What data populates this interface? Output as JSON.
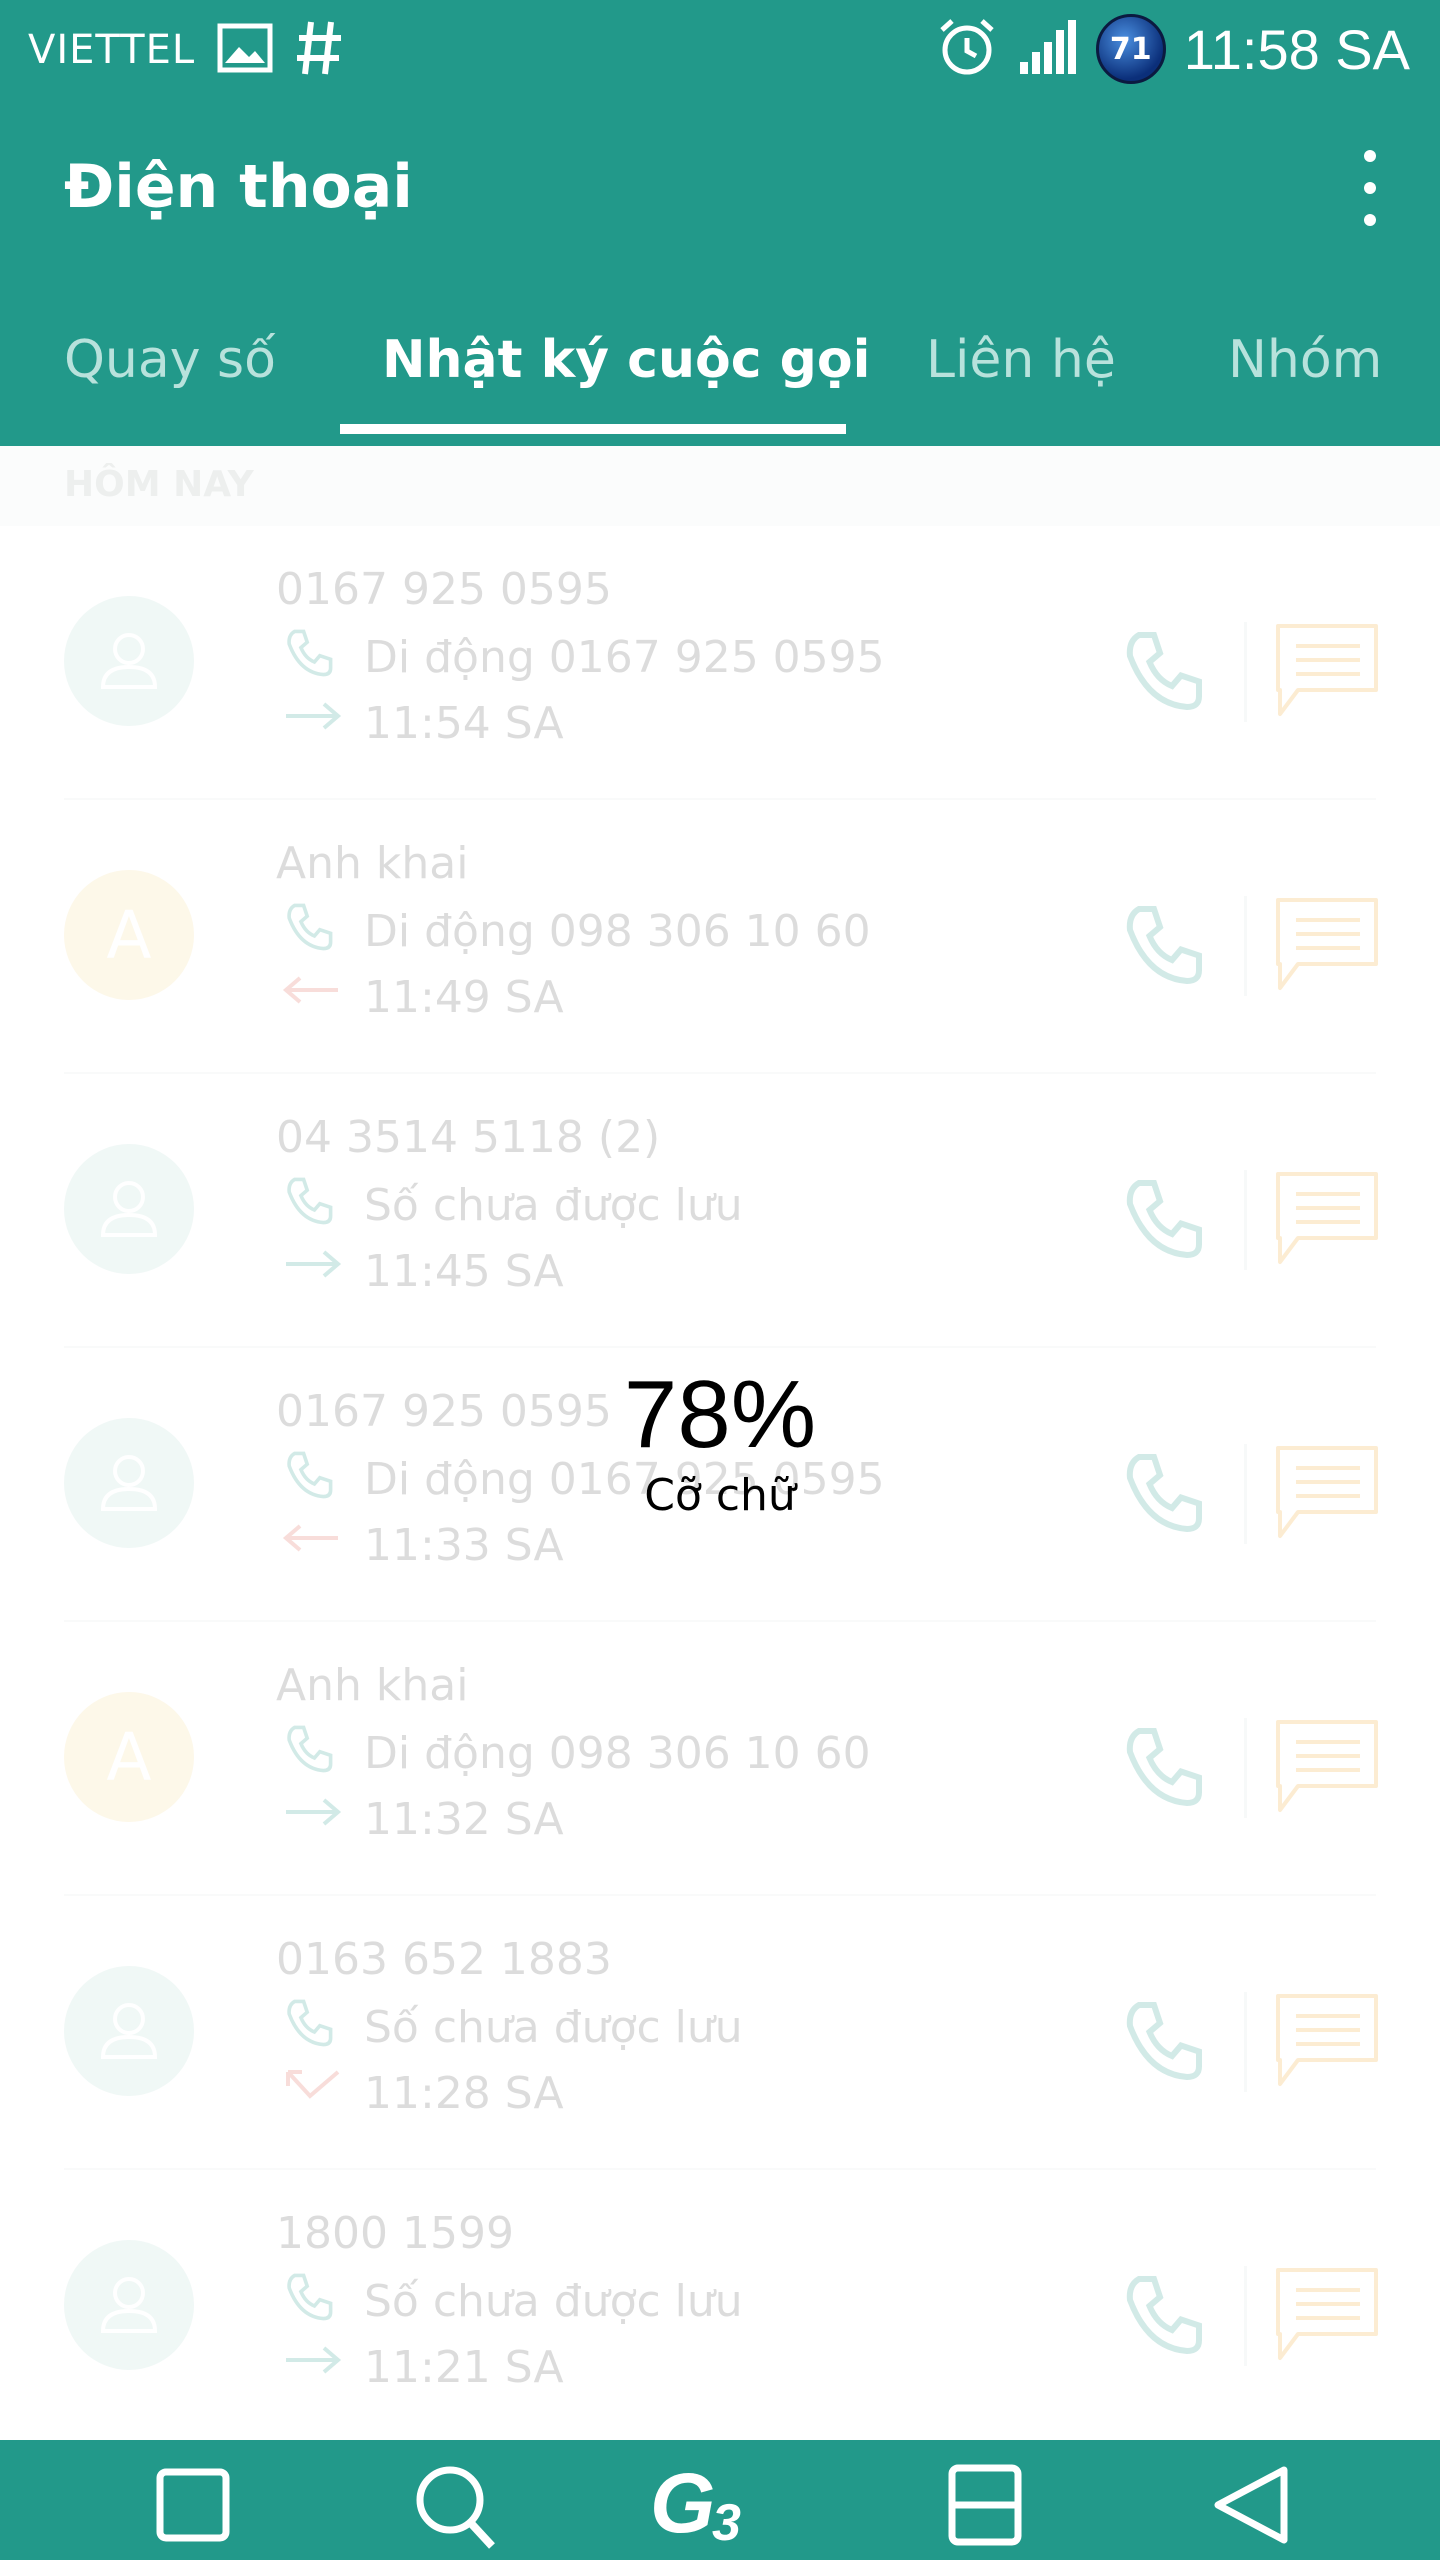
{
  "status_bar": {
    "carrier": "VIETTEL",
    "notification_icons": [
      "image-icon",
      "hashtag-icon"
    ],
    "system_icons": [
      "alarm-icon",
      "signal-icon",
      "battery-icon"
    ],
    "battery_level": "71",
    "time": "11:58 SA"
  },
  "app_bar": {
    "title": "Điện thoại",
    "more_icon": "more-vert-icon"
  },
  "tabs": [
    {
      "label": "Quay số",
      "active": false
    },
    {
      "label": "Nhật ký cuộc gọi",
      "active": true
    },
    {
      "label": "Liên hệ",
      "active": false
    },
    {
      "label": "Nhóm",
      "active": false
    }
  ],
  "call_log": {
    "section_label": "HÔM NAY",
    "items": [
      {
        "name": "0167 925 0595",
        "detail": "Di động  0167 925 0595",
        "time": "11:54 SA",
        "direction": "outgoing",
        "avatar_letter": ""
      },
      {
        "name": "Anh khai",
        "detail": "Di động  098 306 10 60",
        "time": "11:49 SA",
        "direction": "incoming",
        "avatar_letter": "A"
      },
      {
        "name": "04 3514 5118   (2)",
        "detail": "Số chưa được lưu",
        "time": "11:45 SA",
        "direction": "outgoing",
        "avatar_letter": ""
      },
      {
        "name": "0167 925 0595",
        "detail": "Di động  0167 925 0595",
        "time": "11:33 SA",
        "direction": "incoming",
        "avatar_letter": ""
      },
      {
        "name": "Anh khai",
        "detail": "Di động  098 306 10 60",
        "time": "11:32 SA",
        "direction": "outgoing",
        "avatar_letter": "A"
      },
      {
        "name": "0163 652 1883",
        "detail": "Số chưa được lưu",
        "time": "11:28 SA",
        "direction": "missed",
        "avatar_letter": ""
      },
      {
        "name": "1800 1599",
        "detail": "Số chưa được lưu",
        "time": "11:21 SA",
        "direction": "outgoing",
        "avatar_letter": ""
      }
    ]
  },
  "font_size_overlay": {
    "percent": "78%",
    "label": "Cỡ chữ"
  },
  "nav_bar": {
    "buttons": [
      "recent-apps-icon",
      "search-icon",
      "g3-logo-icon",
      "dual-window-icon",
      "back-icon"
    ]
  },
  "colors": {
    "primary": "#22998a",
    "outgoing_arrow": "#22998a",
    "incoming_arrow": "#e05a4a",
    "message_icon": "#f5a623",
    "avatar_default": "#b9ddd7",
    "avatar_letter": "#f8dd95"
  }
}
